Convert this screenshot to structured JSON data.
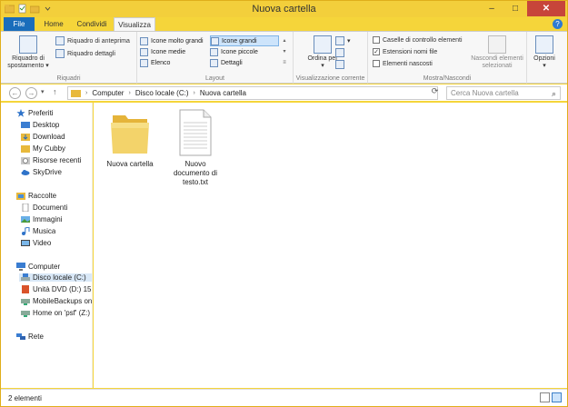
{
  "window": {
    "title": "Nuova cartella"
  },
  "window_controls": {
    "minimize": "–",
    "maximize": "□",
    "close": "✕"
  },
  "tabs": [
    {
      "label": "File"
    },
    {
      "label": "Home"
    },
    {
      "label": "Condividi"
    },
    {
      "label": "Visualizza"
    }
  ],
  "help_label": "?",
  "ribbon": {
    "riquadri": {
      "label": "Riquadri",
      "spostamento": "Riquadro di spostamento",
      "anteprima": "Riquadro di anteprima",
      "dettagli": "Riquadro dettagli"
    },
    "layout": {
      "label": "Layout",
      "items": [
        {
          "label": "Icone molto grandi"
        },
        {
          "label": "Icone grandi"
        },
        {
          "label": "Icone medie"
        },
        {
          "label": "Icone piccole"
        },
        {
          "label": "Elenco"
        },
        {
          "label": "Dettagli"
        }
      ],
      "selected": "Icone grandi"
    },
    "vista_corrente": {
      "label": "Visualizzazione corrente",
      "ordina": "Ordina per"
    },
    "mostra": {
      "label": "Mostra/Nascondi",
      "caselle": {
        "label": "Caselle di controllo elementi",
        "checked": false
      },
      "estensioni": {
        "label": "Estensioni nomi file",
        "checked": true
      },
      "nascosti": {
        "label": "Elementi nascosti",
        "checked": false
      },
      "nascondi_selezionati": "Nascondi elementi selezionati"
    },
    "opzioni": "Opzioni"
  },
  "address": {
    "crumbs": [
      "Computer",
      "Disco locale (C:)",
      "Nuova cartella"
    ],
    "search_placeholder": "Cerca Nuova cartella"
  },
  "nav": {
    "favorites": {
      "label": "Preferiti",
      "items": [
        "Desktop",
        "Download",
        "My Cubby",
        "Risorse recenti",
        "SkyDrive"
      ]
    },
    "libraries": {
      "label": "Raccolte",
      "items": [
        "Documenti",
        "Immagini",
        "Musica",
        "Video"
      ]
    },
    "computer": {
      "label": "Computer",
      "items": [
        "Disco locale (C:)",
        "Unità DVD (D:) 15.0.4",
        "MobileBackups on 'p",
        "Home on 'psf' (Z:)"
      ],
      "selected": "Disco locale (C:)"
    },
    "network": {
      "label": "Rete"
    }
  },
  "files": [
    {
      "name": "Nuova cartella",
      "icon": "folder-icon"
    },
    {
      "name": "Nuovo documento di testo.txt",
      "icon": "text-file-icon"
    }
  ],
  "status": {
    "count": "2 elementi"
  },
  "colors": {
    "titlebar": "#f3cf3b",
    "accent": "#1a6dbb",
    "close": "#c7453a"
  }
}
